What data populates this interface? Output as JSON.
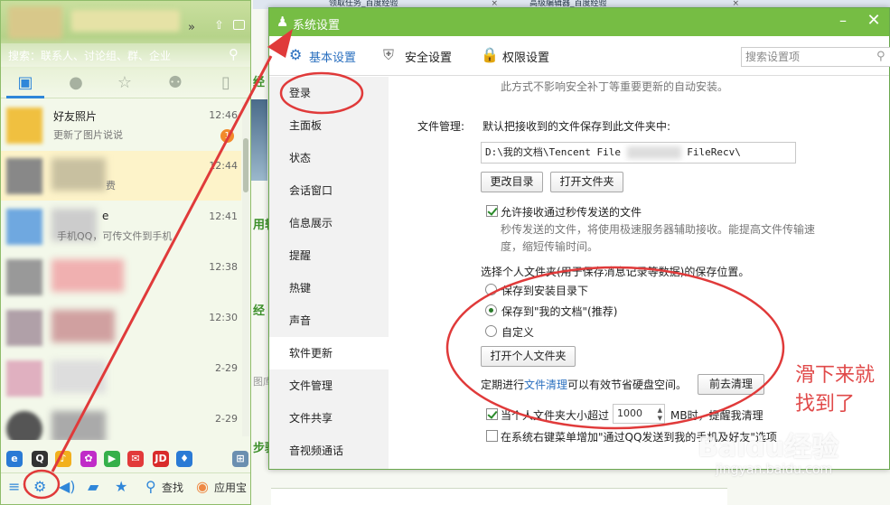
{
  "background": {
    "tabs": [
      "领取任务_百度经验",
      "高级编辑器_百度经验"
    ],
    "snippets": [
      "经",
      "用轴",
      "经",
      "图库",
      "步骤"
    ]
  },
  "qq": {
    "search_placeholder": "搜索：联系人、讨论组、群、企业",
    "contacts": [
      {
        "name": "好友照片",
        "message": "更新了图片说说",
        "time": "12:46",
        "badge": "1"
      },
      {
        "name": "",
        "message": "费",
        "time": "12:44"
      },
      {
        "name": "e",
        "message": "手机QQ，可传文件到手机",
        "time": "12:41"
      },
      {
        "name": "",
        "message": "",
        "time": "12:38"
      },
      {
        "name": "",
        "message": "",
        "time": "12:30"
      },
      {
        "name": "",
        "message": "",
        "time": "2-29"
      },
      {
        "name": "",
        "message": "",
        "time": "2-29"
      }
    ],
    "bottom": {
      "find_label": "查找",
      "app_label": "应用宝"
    }
  },
  "dialog": {
    "title": "系统设置",
    "tabs": [
      "基本设置",
      "安全设置",
      "权限设置"
    ],
    "search_placeholder": "搜索设置项",
    "sidebar": [
      "登录",
      "主面板",
      "状态",
      "会话窗口",
      "信息展示",
      "提醒",
      "热键",
      "声音",
      "软件更新",
      "文件管理",
      "文件共享",
      "音视频通话"
    ],
    "content": {
      "update_note": "此方式不影响安全补丁等重要更新的自动安装。",
      "file_mgmt_label": "文件管理:",
      "default_save_text": "默认把接收到的文件保存到此文件夹中:",
      "path_value": "D:\\我的文档\\Tencent File",
      "path_suffix": "FileRecv\\",
      "change_dir_btn": "更改目录",
      "open_folder_btn": "打开文件夹",
      "allow_fast_label": "允许接收通过秒传发送的文件",
      "fast_desc_1": "秒传发送的文件，将使用极速服务器辅助接收。能提高文件传输速",
      "fast_desc_2": "度，缩短传输时间。",
      "personal_folder_text": "选择个人文件夹(用于保存消息记录等数据)的保存位置。",
      "radio_1": "保存到安装目录下",
      "radio_2": "保存到\"我的文档\"(推荐)",
      "radio_3": "自定义",
      "open_personal_btn": "打开个人文件夹",
      "clean_prefix": "定期进行",
      "clean_link": "文件清理",
      "clean_suffix": "可以有效节省硬盘空间。",
      "clean_btn": "前去清理",
      "size_prefix": "当个人文件夹大小超过",
      "size_value": "1000",
      "size_suffix": "MB时，提醒我清理",
      "context_menu_label": "在系统右键菜单增加\"通过QQ发送到我的手机及好友\"选项"
    }
  },
  "annotation": {
    "note": "滑下来就找到了",
    "watermark": "Baidu经验",
    "watermark_sub": "jingyan.baidu.com"
  },
  "colors": {
    "title_bar": "#76bd44",
    "accent_blue": "#2a6fbf",
    "annotation_red": "#e03a3a"
  }
}
